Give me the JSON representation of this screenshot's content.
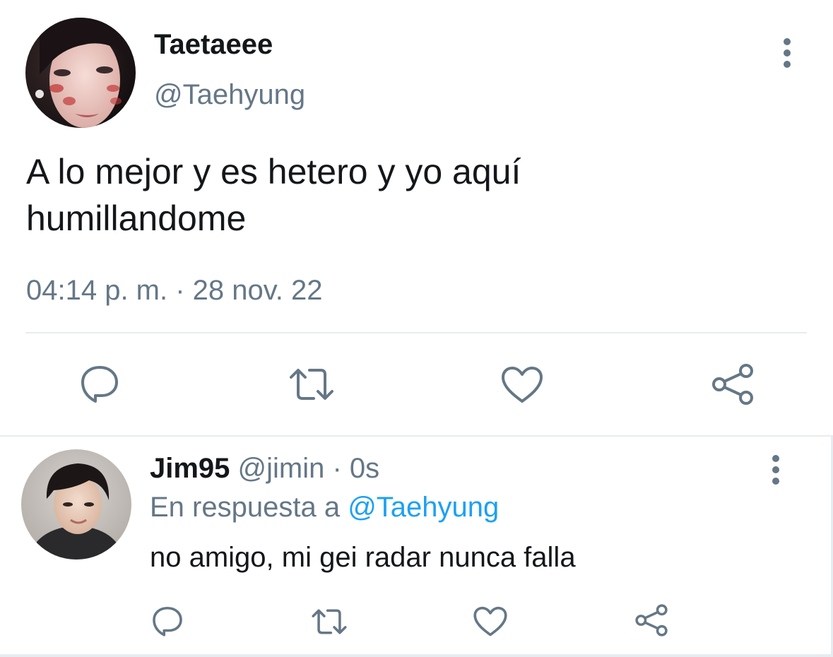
{
  "main_tweet": {
    "display_name": "Taetaeee",
    "handle": "@Taehyung",
    "text_line1": "A lo mejor y es hetero y yo aquí",
    "text_line2": "humillandome",
    "timestamp": "04:14 p. m. · 28 nov. 22"
  },
  "reply": {
    "display_name": "Jim95",
    "handle_time": " @jimin · 0s",
    "in_reply_to": "En respuesta a ",
    "mention": "@Taehyung",
    "text": "no amigo, mi gei radar nunca falla"
  },
  "colors": {
    "text": "#14171a",
    "secondary": "#657786",
    "accent": "#1da1f2",
    "icon": "#657786",
    "divider": "#e6ecf0"
  },
  "icons": [
    "reply-icon",
    "retweet-icon",
    "like-icon",
    "share-icon",
    "more-icon"
  ]
}
